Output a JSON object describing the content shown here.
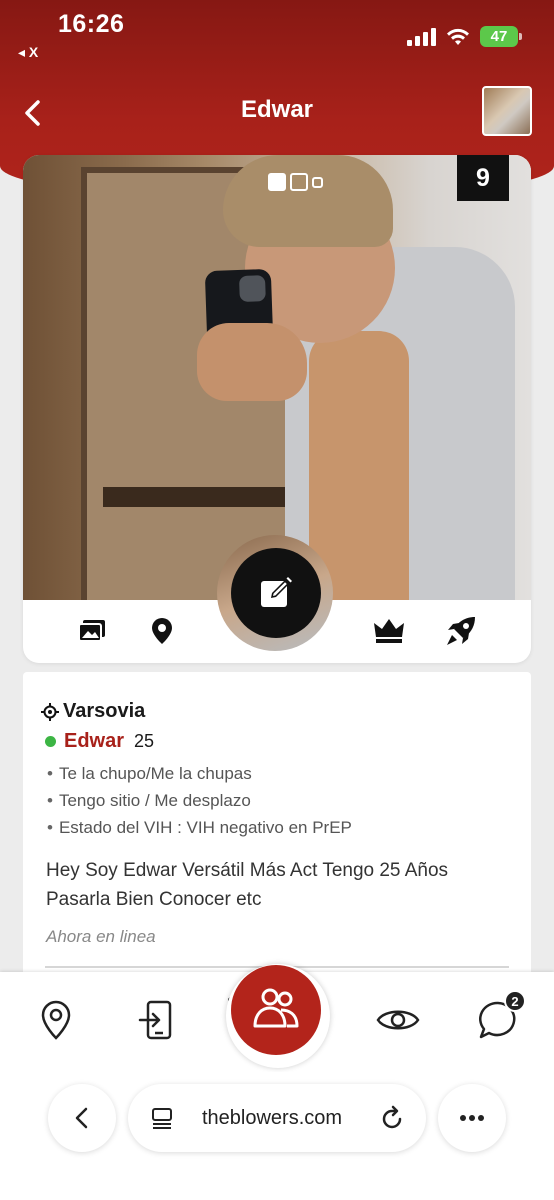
{
  "status_bar": {
    "time": "16:26",
    "back_label": "◂ X",
    "battery": "47"
  },
  "header": {
    "title": "Edwar"
  },
  "photo": {
    "dots": 3,
    "active_dot": 0,
    "count": "9"
  },
  "card_icons": [
    "gallery-icon",
    "location-pin-icon",
    "crown-icon",
    "rocket-icon"
  ],
  "profile": {
    "location": "Varsovia",
    "name": "Edwar",
    "age": "25",
    "details": [
      "Te la chupo/Me la chupas",
      "Tengo sitio / Me desplazo",
      "Estado del VIH : VIH negativo en PrEP"
    ],
    "bio": "Hey Soy Edwar Versátil Más Act Tengo 25 Años Pasarla Bien Conocer etc",
    "status": "Ahora en linea"
  },
  "tabbar": {
    "messages_badge": "2"
  },
  "browser": {
    "url": "theblowers.com"
  },
  "colors": {
    "brand_red": "#a8211a",
    "online": "#3cb544",
    "dark": "#111111"
  }
}
